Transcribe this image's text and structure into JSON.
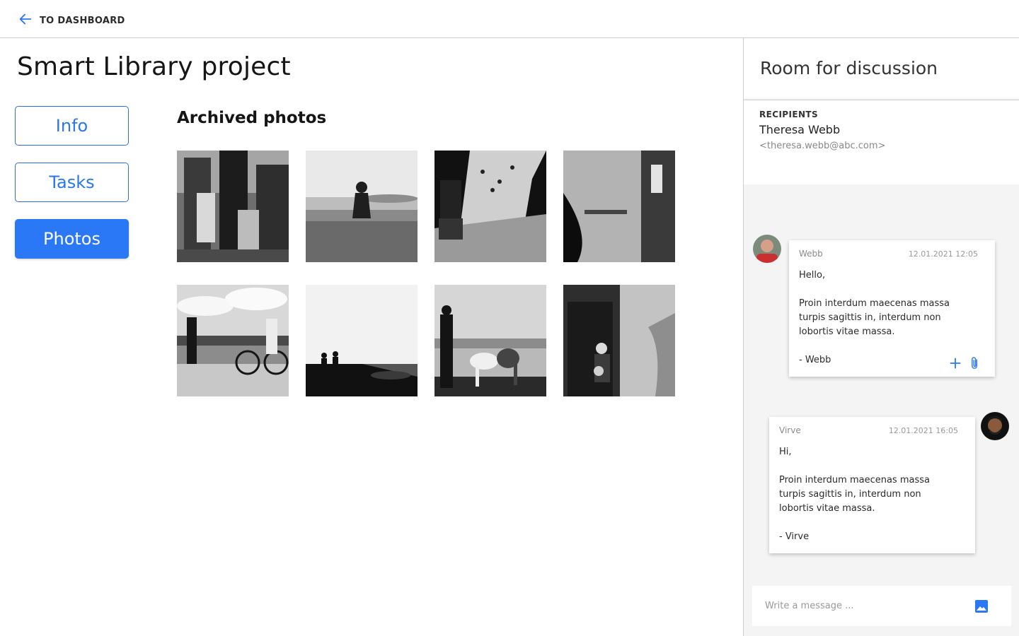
{
  "topbar": {
    "back_label": "TO DASHBOARD"
  },
  "main": {
    "title": "Smart Library project",
    "nav": [
      {
        "label": "Info",
        "active": false
      },
      {
        "label": "Tasks",
        "active": false
      },
      {
        "label": "Photos",
        "active": true
      }
    ],
    "section_title": "Archived photos",
    "photo_count": 8
  },
  "discussion": {
    "title": "Room for discussion",
    "recipients_label": "RECIPIENTS",
    "recipient_name": "Theresa Webb",
    "recipient_email": "<theresa.webb@abc.com>",
    "messages": [
      {
        "author": "Webb",
        "time": "12.01.2021 12:05",
        "greeting": "Hello,",
        "body": "Proin interdum maecenas massa turpis sagittis in, interdum non lobortis vitae massa.",
        "signature": "- Webb"
      },
      {
        "author": "Virve",
        "time": "12.01.2021 16:05",
        "greeting": "Hi,",
        "body": "Proin interdum maecenas massa turpis sagittis in, interdum non lobortis vitae massa.",
        "signature": "- Virve"
      }
    ],
    "composer_placeholder": "Write a message ..."
  },
  "colors": {
    "accent": "#2a78f6",
    "panel_bg": "#f4f4f4",
    "border": "#cfcfcf"
  },
  "icons": [
    "arrow-left-icon",
    "plus-icon",
    "paperclip-icon",
    "image-icon"
  ]
}
